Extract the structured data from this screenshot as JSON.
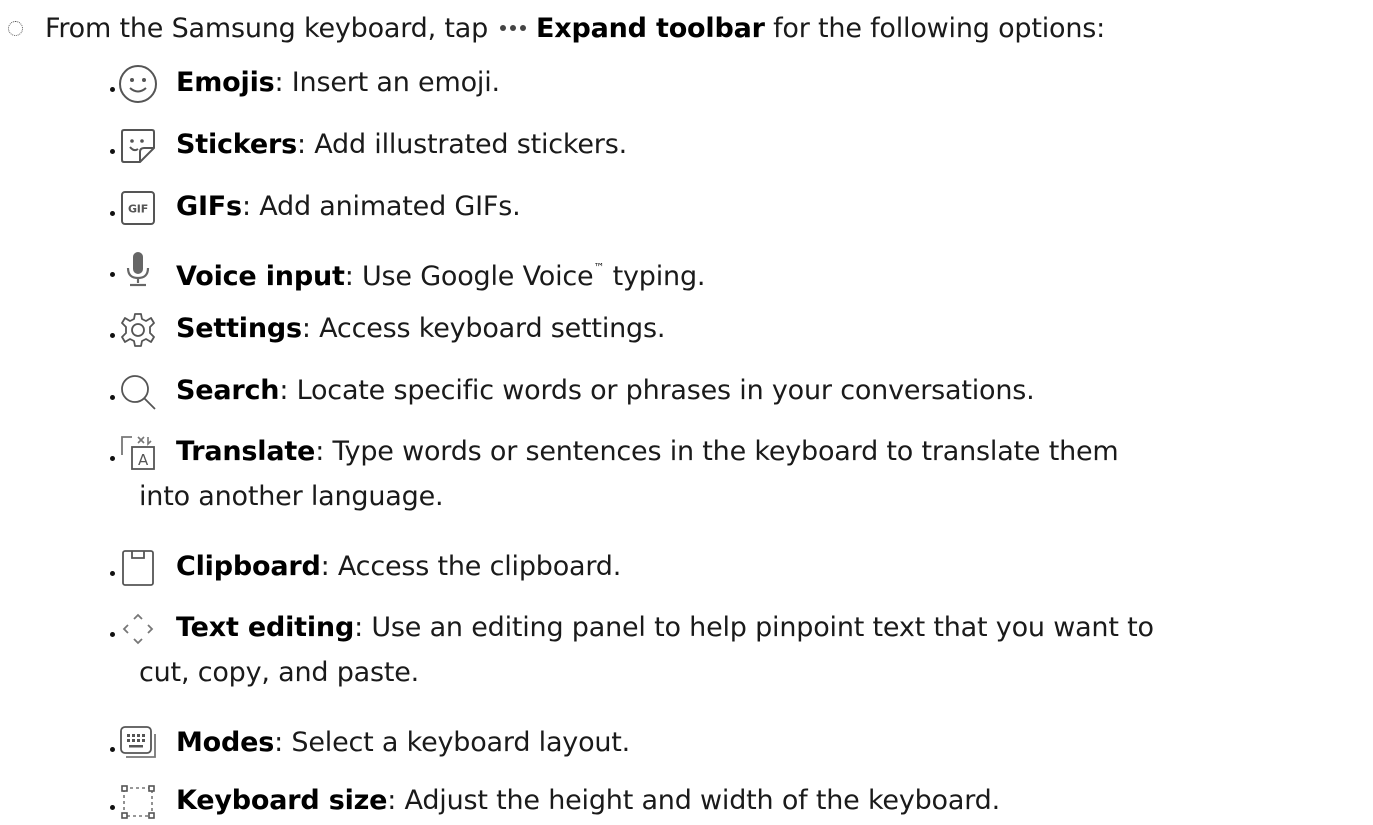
{
  "intro": {
    "prefix": "From the Samsung keyboard, tap",
    "action": "Expand toolbar",
    "suffix": "for the following options:",
    "icon": "more-dots-icon"
  },
  "items": [
    {
      "icon": "emoji-icon",
      "title": "Emojis",
      "desc": ": Insert an emoji."
    },
    {
      "icon": "sticker-icon",
      "title": "Stickers",
      "desc": ": Add illustrated stickers."
    },
    {
      "icon": "gif-icon",
      "title": "GIFs",
      "desc": ": Add animated GIFs."
    },
    {
      "icon": "microphone-icon",
      "title": "Voice input",
      "desc": ": Use Google Voice",
      "tm": "™",
      "desc2": " typing."
    },
    {
      "icon": "gear-icon",
      "title": "Settings",
      "desc": ": Access keyboard settings."
    },
    {
      "icon": "search-icon",
      "title": "Search",
      "desc": ": Locate specific words or phrases in your conversations."
    },
    {
      "icon": "translate-icon",
      "title": "Translate",
      "desc": ": Type words or sentences in the keyboard to translate them",
      "cont": "into another language."
    },
    {
      "icon": "clipboard-icon",
      "title": "Clipboard",
      "desc": ": Access the clipboard."
    },
    {
      "icon": "text-editing-icon",
      "title": "Text editing",
      "desc": ": Use an editing panel to help pinpoint text that you want to",
      "cont": "cut, copy, and paste."
    },
    {
      "icon": "keyboard-modes-icon",
      "title": "Modes",
      "desc": ": Select a keyboard layout."
    },
    {
      "icon": "keyboard-size-icon",
      "title": "Keyboard size",
      "desc": ": Adjust the height and width of the keyboard."
    }
  ]
}
